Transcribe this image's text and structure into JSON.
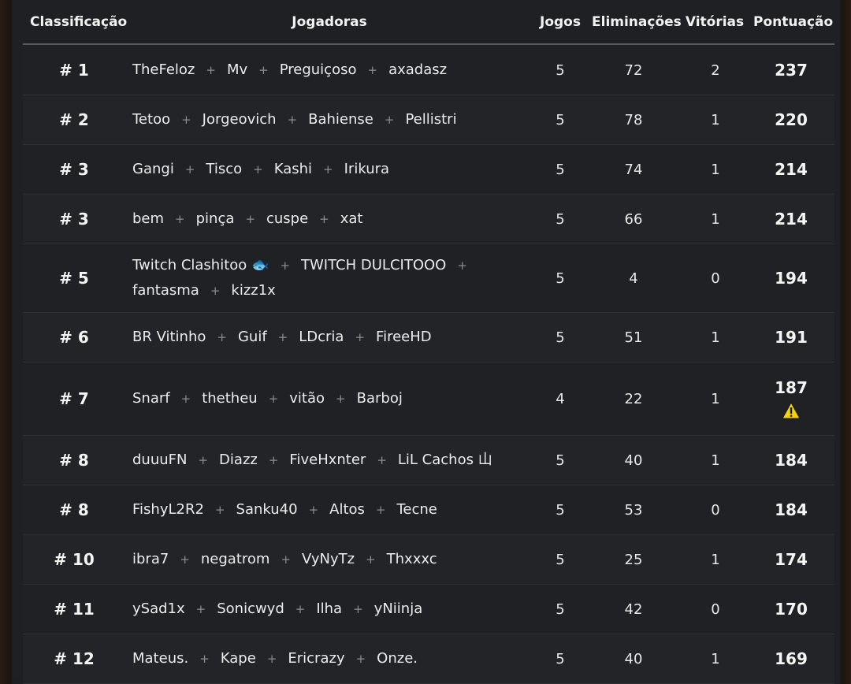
{
  "header": {
    "rank": "Classificação",
    "players": "Jogadoras",
    "games": "Jogos",
    "eliminations": "Eliminações",
    "wins": "Vitórias",
    "points": "Pontuação"
  },
  "separator": "+",
  "warning_color": "#f5d400",
  "rows": [
    {
      "rank": "# 1",
      "players": [
        "TheFeloz",
        "Mv",
        "Preguiçoso",
        "axadasz"
      ],
      "games": "5",
      "eliminations": "72",
      "wins": "2",
      "points": "237"
    },
    {
      "rank": "# 2",
      "players": [
        "Tetoo",
        "Jorgeovich",
        "Bahiense",
        "Pellistri"
      ],
      "games": "5",
      "eliminations": "78",
      "wins": "1",
      "points": "220"
    },
    {
      "rank": "# 3",
      "players": [
        "Gangi",
        "Tisco",
        "Kashi",
        "Irikura"
      ],
      "games": "5",
      "eliminations": "74",
      "wins": "1",
      "points": "214"
    },
    {
      "rank": "# 3",
      "players": [
        "bem",
        "pinça",
        "cuspe",
        "xat"
      ],
      "games": "5",
      "eliminations": "66",
      "wins": "1",
      "points": "214"
    },
    {
      "rank": "# 5",
      "players": [
        "Twitch Clashitoo 🐟",
        "TWITCH DULCITOOO",
        "fantasma",
        "kizz1x"
      ],
      "games": "5",
      "eliminations": "4",
      "wins": "0",
      "points": "194"
    },
    {
      "rank": "# 6",
      "players": [
        "BR Vitinho",
        "Guif",
        "LDcria",
        "FireeHD"
      ],
      "games": "5",
      "eliminations": "51",
      "wins": "1",
      "points": "191"
    },
    {
      "rank": "# 7",
      "players": [
        "Snarf",
        "thetheu",
        "vitão",
        "Barboj"
      ],
      "games": "4",
      "eliminations": "22",
      "wins": "1",
      "points": "187",
      "warning": true
    },
    {
      "rank": "# 8",
      "players": [
        "duuuFN",
        "Diazz",
        "FiveHxnter",
        "LiL Cachos 山"
      ],
      "games": "5",
      "eliminations": "40",
      "wins": "1",
      "points": "184"
    },
    {
      "rank": "# 8",
      "players": [
        "FishyL2R2",
        "Sanku40",
        "Altos",
        "Tecne"
      ],
      "games": "5",
      "eliminations": "53",
      "wins": "0",
      "points": "184"
    },
    {
      "rank": "# 10",
      "players": [
        "ibra7",
        "negatrom",
        "VyNyTz",
        "Thxxxc"
      ],
      "games": "5",
      "eliminations": "25",
      "wins": "1",
      "points": "174"
    },
    {
      "rank": "# 11",
      "players": [
        "ySad1x",
        "Sonicwyd",
        "Ilha",
        "yNiinja"
      ],
      "games": "5",
      "eliminations": "42",
      "wins": "0",
      "points": "170"
    },
    {
      "rank": "# 12",
      "players": [
        "Mateus.",
        "Kape",
        "Ericrazy",
        "Onze."
      ],
      "games": "5",
      "eliminations": "40",
      "wins": "1",
      "points": "169"
    }
  ]
}
